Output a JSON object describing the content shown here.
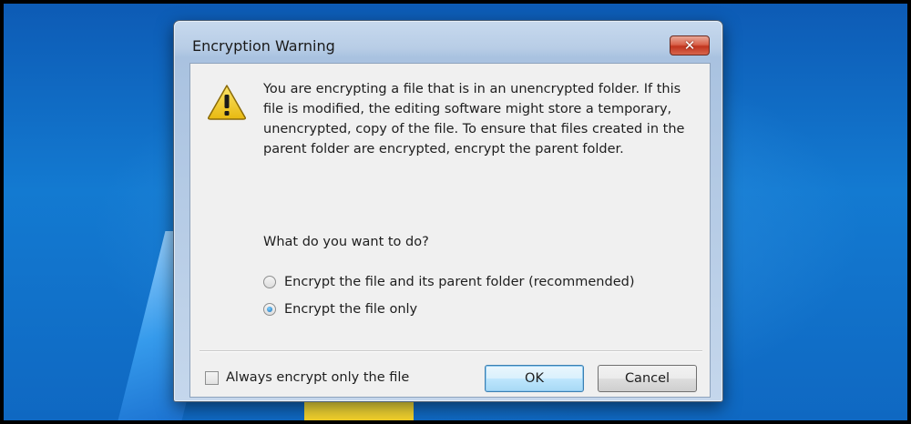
{
  "window": {
    "title": "Encryption Warning",
    "close_label": "✕"
  },
  "message": "You are encrypting a file that is in an unencrypted folder. If this file is modified, the editing software might store a temporary, unencrypted, copy of the file. To ensure that files created in the parent folder are encrypted, encrypt the parent folder.",
  "question": "What do you want to do?",
  "options": [
    {
      "label": "Encrypt the file and its parent folder (recommended)",
      "checked": false
    },
    {
      "label": "Encrypt the file only",
      "checked": true
    }
  ],
  "always_checkbox": {
    "label": "Always encrypt only the file",
    "checked": false
  },
  "buttons": {
    "ok": "OK",
    "cancel": "Cancel"
  },
  "icons": {
    "warning": "warning-icon",
    "close": "close-icon"
  },
  "colors": {
    "warning_fill": "#f4d23a",
    "accent": "#3c7fb1"
  }
}
